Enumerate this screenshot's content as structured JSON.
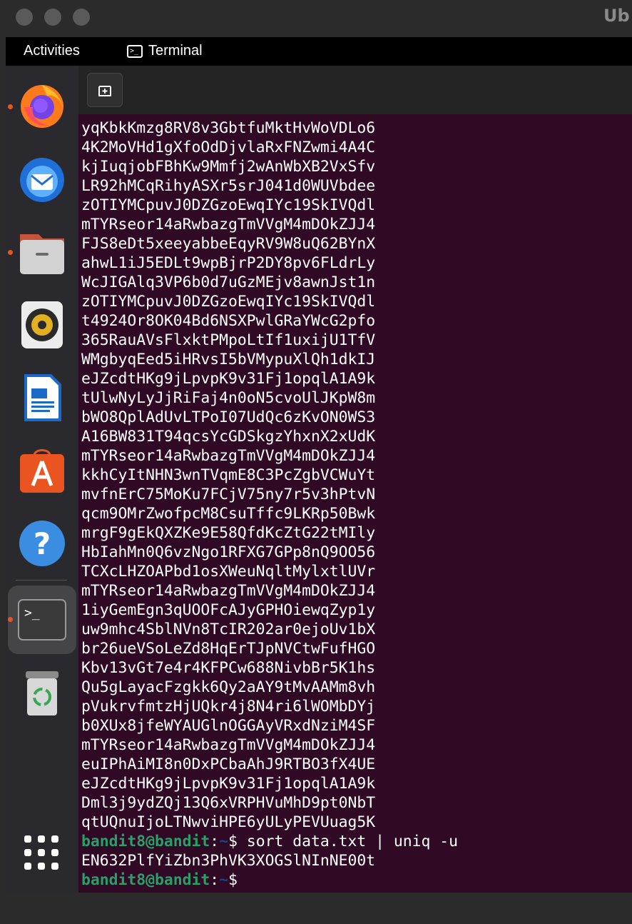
{
  "window": {
    "title": "Ub"
  },
  "topbar": {
    "activities_label": "Activities",
    "app_menu_label": "Terminal"
  },
  "dock": {
    "items": [
      {
        "name": "Firefox",
        "icon": "firefox-icon",
        "running": true
      },
      {
        "name": "Thunderbird",
        "icon": "thunderbird-icon",
        "running": false
      },
      {
        "name": "Files",
        "icon": "files-icon",
        "running": true
      },
      {
        "name": "Rhythmbox",
        "icon": "rhythmbox-icon",
        "running": false
      },
      {
        "name": "LibreOffice Writer",
        "icon": "writer-icon",
        "running": false
      },
      {
        "name": "Ubuntu Software",
        "icon": "software-icon",
        "running": false
      },
      {
        "name": "Help",
        "icon": "help-icon",
        "running": false
      },
      {
        "name": "Terminal",
        "icon": "terminal-icon",
        "running": true
      },
      {
        "name": "Trash",
        "icon": "trash-icon",
        "running": false
      }
    ],
    "apps_grid_icon": "show-applications-icon"
  },
  "terminal": {
    "new_tab_icon": "new-tab-icon",
    "output_lines": [
      "yqKbkKmzg8RV8v3GbtfuMktHvWoVDLo6",
      "4K2MoVHd1gXfoOdDjvlaRxFNZwmi4A4C",
      "kjIuqjobFBhKw9Mmfj2wAnWbXB2VxSfv",
      "LR92hMCqRihyASXr5srJ041d0WUVbdee",
      "zOTIYMCpuvJ0DZGzoEwqIYc19SkIVQdl",
      "mTYRseor14aRwbazgTmVVgM4mDOkZJJ4",
      "FJS8eDt5xeeyabbeEqyRV9W8uQ62BYnX",
      "ahwL1iJ5EDLt9wpBjrP2DY8pv6FLdrLy",
      "WcJIGAlq3VP6b0d7uGzMEjv8awnJst1n",
      "zOTIYMCpuvJ0DZGzoEwqIYc19SkIVQdl",
      "t4924Or8OK04Bd6NSXPwlGRaYWcG2pfo",
      "365RauAVsFlxktPMpoLtIf1uxijU1TfV",
      "WMgbyqEed5iHRvsI5bVMypuXlQh1dkIJ",
      "eJZcdtHKg9jLpvpK9v31Fj1opqlA1A9k",
      "tUlwNyLyJjRiFaj4n0oN5cvoUlJKpW8m",
      "bWO8QplAdUvLTPoI07UdQc6zKvON0WS3",
      "A16BW831T94qcsYcGDSkgzYhxnX2xUdK",
      "mTYRseor14aRwbazgTmVVgM4mDOkZJJ4",
      "kkhCyItNHN3wnTVqmE8C3PcZgbVCWuYt",
      "mvfnErC75MoKu7FCjV75ny7r5v3hPtvN",
      "qcm9OMrZwofpcM8CsuTffc9LKRp50Bwk",
      "mrgF9gEkQXZKe9E58QfdKcZtG22tMIly",
      "HbIahMn0Q6vzNgo1RFXG7GPp8nQ9OO56",
      "TCXcLHZOAPbd1osXWeuNqltMylxtlUVr",
      "mTYRseor14aRwbazgTmVVgM4mDOkZJJ4",
      "1iyGemEgn3qUOOFcAJyGPHOiewqZyp1y",
      "uw9mhc4SblNVn8TcIR202ar0ejoUv1bX",
      "br26ueVSoLeZd8HqErTJpNVCtwFufHGO",
      "Kbv13vGt7e4r4KFPCw688NivbBr5K1hs",
      "Qu5gLayacFzgkk6Qy2aAY9tMvAAMm8vh",
      "pVukrvfmtzHjUQkr4j8N4ri6lWOMbDYj",
      "b0XUx8jfeWYAUGlnOGGAyVRxdNziM4SF",
      "mTYRseor14aRwbazgTmVVgM4mDOkZJJ4",
      "euIPhAiMI8n0DxPCbaAhJ9RTBO3fX4UE",
      "eJZcdtHKg9jLpvpK9v31Fj1opqlA1A9k",
      "Dml3j9ydZQj13Q6xVRPHVuMhD9pt0NbT",
      "qtUQnuIjoLTNwviHPE6yULyPEVUuag5K"
    ],
    "prompt1": {
      "user_host": "bandit8@bandit",
      "sep": ":",
      "path": "~",
      "symbol": "$ ",
      "command": "sort data.txt | uniq -u"
    },
    "result_line": "EN632PlfYiZbn3PhVK3XOGSlNInNE00t",
    "prompt2": {
      "user_host": "bandit8@bandit",
      "sep": ":",
      "path": "~",
      "symbol": "$"
    }
  }
}
